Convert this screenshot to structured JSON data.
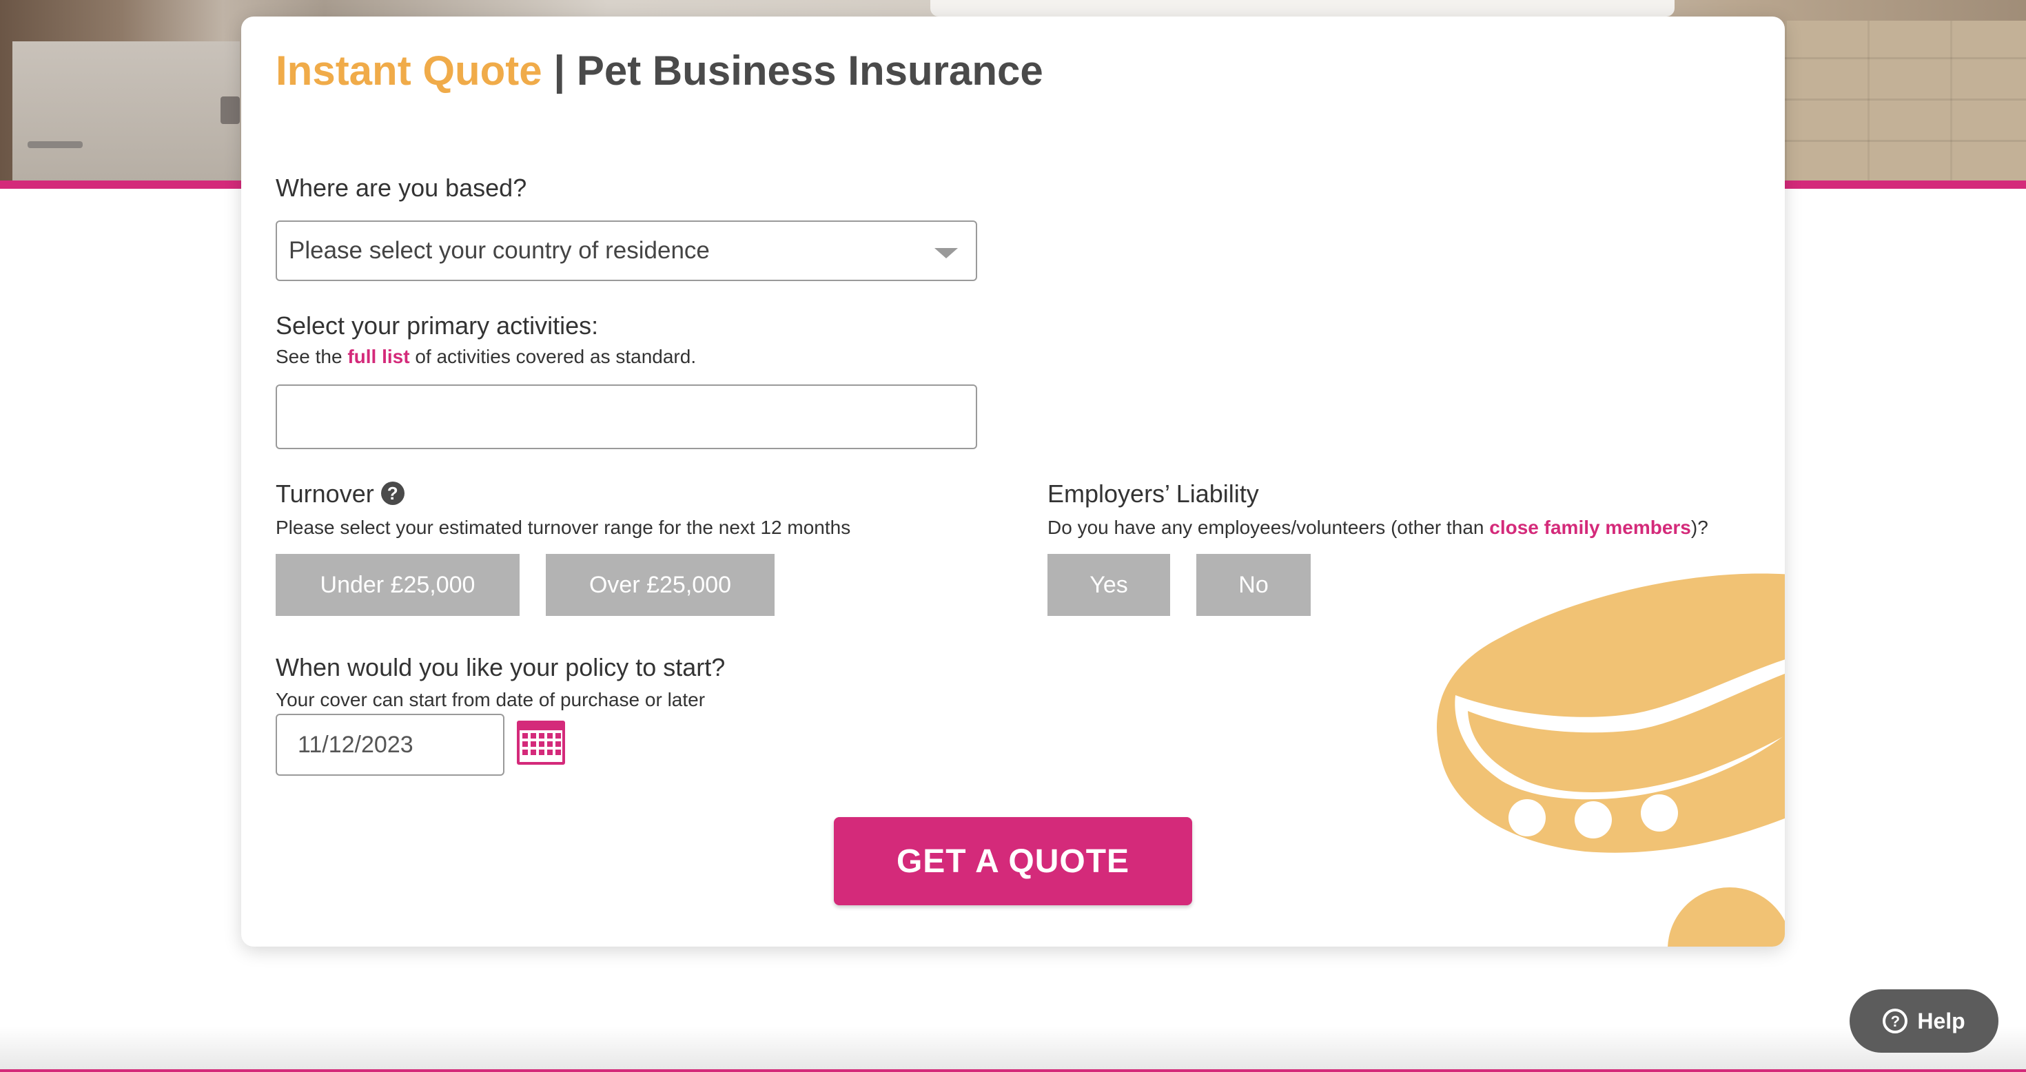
{
  "header": {
    "title_accent": "Instant Quote",
    "title_separator": "|",
    "title_main": "Pet Business Insurance"
  },
  "location": {
    "label": "Where are you based?",
    "select_value": "Please select your country of residence"
  },
  "activities": {
    "label": "Select your primary activities:",
    "hint_before": "See the",
    "hint_link": "full list",
    "hint_after": "of activities covered as standard.",
    "input_value": ""
  },
  "turnover": {
    "label": "Turnover",
    "help_icon": "question-circle-icon",
    "hint": "Please select your estimated turnover range for the next 12 months",
    "options": [
      "Under £25,000",
      "Over £25,000"
    ]
  },
  "employers_liability": {
    "label": "Employers’ Liability",
    "hint_before": "Do you have any employees/volunteers (other than",
    "hint_link": "close family members",
    "hint_after": ")?",
    "options": [
      "Yes",
      "No"
    ]
  },
  "policy_start": {
    "label": "When would you like your policy to start?",
    "hint": "Your cover can start from date of purchase or later",
    "date_value": "11/12/2023",
    "calendar_icon": "calendar-icon"
  },
  "cta": {
    "label": "GET A QUOTE"
  },
  "help_widget": {
    "label": "Help",
    "icon": "question-circle-icon"
  },
  "colors": {
    "accent_orange": "#f0ab49",
    "brand_pink": "#d42a7a",
    "option_grey": "#b3b3b3",
    "collar_orange": "#f1c274"
  }
}
